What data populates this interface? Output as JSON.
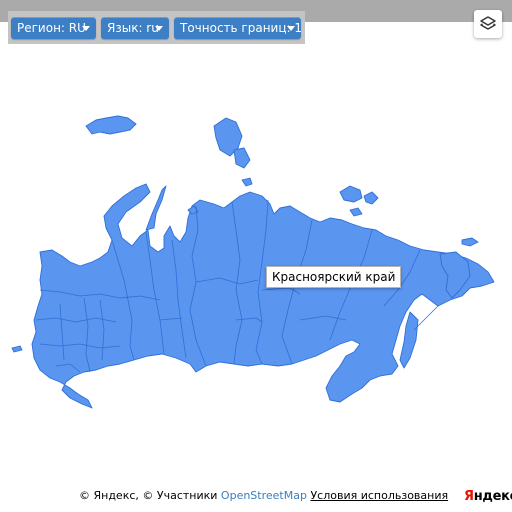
{
  "controls": {
    "region": "Регион: RU",
    "language": "Язык: ru",
    "precision": "Точность границ: 1"
  },
  "layers_button": {
    "icon": "layers-icon"
  },
  "map": {
    "country": "Russia",
    "fill_color": "#5a96f0",
    "border_color": "#2f6fd6",
    "tooltip": "Красноярский край"
  },
  "attribution": {
    "prefix": "© Яндекс, © Участники",
    "osm_link": "OpenStreetMap",
    "terms_link": "Условия использования"
  },
  "logo": {
    "first_letter": "Я",
    "rest": "ндекс"
  }
}
